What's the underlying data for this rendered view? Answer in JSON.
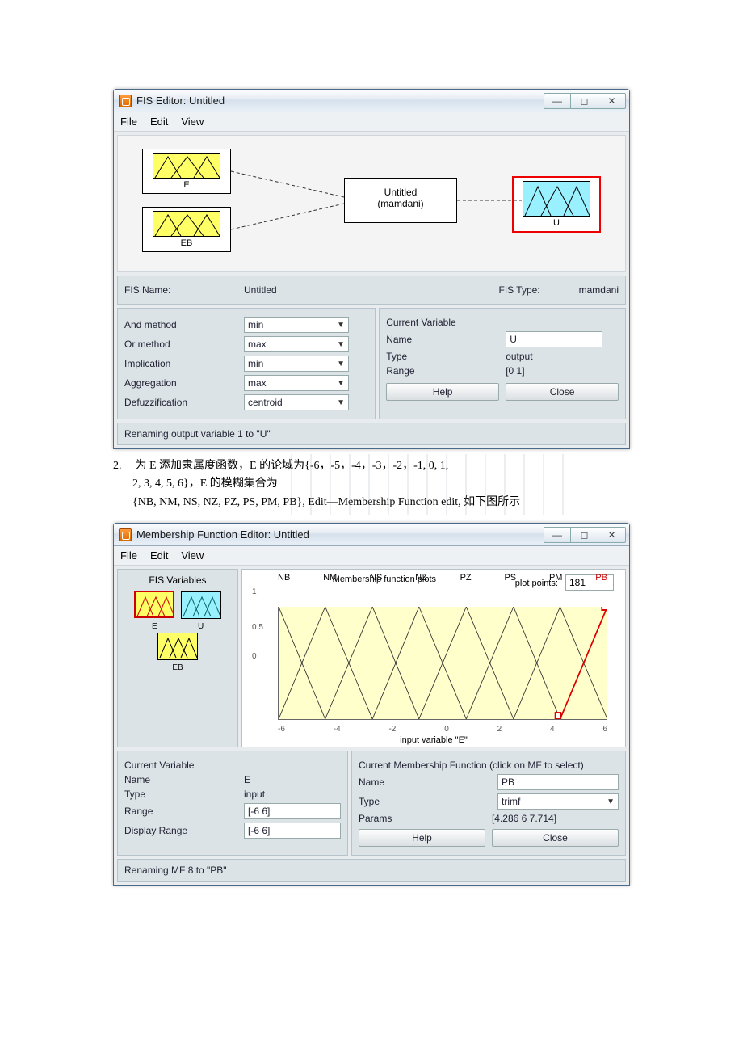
{
  "doc": {
    "step_number": "2.",
    "step_line1": "为 E 添加隶属度函数，E 的论域为{-6，-5，-4，-3，-2，-1, 0, 1,",
    "step_line2": "2, 3, 4, 5, 6}，E 的模糊集合为",
    "step_line3": "{NB, NM, NS, NZ, PZ, PS, PM, PB}, Edit—Membership  Function  edit, 如下图所示"
  },
  "fis_editor": {
    "title": "FIS Editor: Untitled",
    "menu": {
      "file": "File",
      "edit": "Edit",
      "view": "View"
    },
    "vars": {
      "in1": "E",
      "in2": "EB",
      "out": "U"
    },
    "sys": {
      "name_line": "Untitled",
      "type_line": "(mamdani)"
    },
    "name_row": {
      "label": "FIS Name:",
      "value": "Untitled",
      "type_label": "FIS Type:",
      "type_value": "mamdani"
    },
    "methods": {
      "and": {
        "label": "And method",
        "value": "min"
      },
      "or": {
        "label": "Or method",
        "value": "max"
      },
      "imp": {
        "label": "Implication",
        "value": "min"
      },
      "agg": {
        "label": "Aggregation",
        "value": "max"
      },
      "def": {
        "label": "Defuzzification",
        "value": "centroid"
      }
    },
    "curvar": {
      "header": "Current Variable",
      "name_label": "Name",
      "name_value": "U",
      "type_label": "Type",
      "type_value": "output",
      "range_label": "Range",
      "range_value": "[0 1]"
    },
    "buttons": {
      "help": "Help",
      "close": "Close"
    },
    "status": "Renaming output variable 1 to \"U\""
  },
  "mf_editor": {
    "title": "Membership Function Editor: Untitled",
    "menu": {
      "file": "File",
      "edit": "Edit",
      "view": "View"
    },
    "left_header": "FIS Variables",
    "left_vars": {
      "e": "E",
      "u": "U",
      "eb": "EB"
    },
    "plot": {
      "heading": "Membership function plots",
      "pp_label": "plot points:",
      "pp_value": "181",
      "mf_labels": [
        "NB",
        "NM",
        "NS",
        "NZ",
        "PZ",
        "PS",
        "PM",
        "PB"
      ],
      "yticks": [
        "1",
        "0.5",
        "0"
      ],
      "xticks": [
        "-6",
        "-4",
        "-2",
        "0",
        "2",
        "4",
        "6"
      ],
      "xlabel": "input variable \"E\""
    },
    "curvar": {
      "header": "Current Variable",
      "name_label": "Name",
      "name_value": "E",
      "type_label": "Type",
      "type_value": "input",
      "range_label": "Range",
      "range_value": "[-6 6]",
      "drange_label": "Display Range",
      "drange_value": "[-6 6]"
    },
    "curmf": {
      "header": "Current Membership Function (click on MF to select)",
      "name_label": "Name",
      "name_value": "PB",
      "type_label": "Type",
      "type_value": "trimf",
      "params_label": "Params",
      "params_value": "[4.286 6 7.714]"
    },
    "buttons": {
      "help": "Help",
      "close": "Close"
    },
    "status": "Renaming MF 8 to \"PB\""
  },
  "chart_data": {
    "type": "line",
    "title": "Membership function plots",
    "xlabel": "input variable \"E\"",
    "ylabel": "",
    "xlim": [
      -6,
      6
    ],
    "ylim": [
      0,
      1
    ],
    "xticks": [
      -6,
      -4,
      -2,
      0,
      2,
      4,
      6
    ],
    "yticks": [
      0,
      0.5,
      1
    ],
    "series": [
      {
        "name": "NB",
        "type": "trimf",
        "params": [
          -7.714,
          -6,
          -4.286
        ]
      },
      {
        "name": "NM",
        "type": "trimf",
        "params": [
          -6,
          -4.286,
          -2.571
        ]
      },
      {
        "name": "NS",
        "type": "trimf",
        "params": [
          -4.286,
          -2.571,
          -0.857
        ]
      },
      {
        "name": "NZ",
        "type": "trimf",
        "params": [
          -2.571,
          -0.857,
          0.857
        ]
      },
      {
        "name": "PZ",
        "type": "trimf",
        "params": [
          -0.857,
          0.857,
          2.571
        ]
      },
      {
        "name": "PS",
        "type": "trimf",
        "params": [
          0.857,
          2.571,
          4.286
        ]
      },
      {
        "name": "PM",
        "type": "trimf",
        "params": [
          2.571,
          4.286,
          6
        ]
      },
      {
        "name": "PB",
        "type": "trimf",
        "params": [
          4.286,
          6,
          7.714
        ],
        "selected": true
      }
    ]
  }
}
